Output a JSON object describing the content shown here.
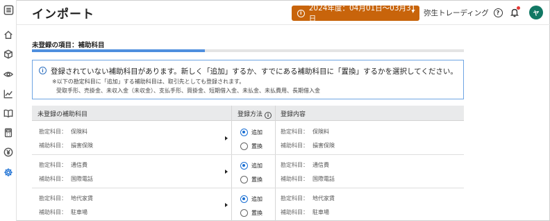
{
  "header": {
    "title": "インポート",
    "period_label": "2024年度：04月01日〜03月31日",
    "company": "弥生トレーディング",
    "avatar_initial": "ヤ"
  },
  "sidebar": {
    "items": [
      {
        "icon": "menu-icon"
      },
      {
        "icon": "home-icon"
      },
      {
        "icon": "box-icon"
      },
      {
        "icon": "eye-icon"
      },
      {
        "icon": "chart-icon"
      },
      {
        "icon": "book-icon"
      },
      {
        "icon": "calculator-icon"
      },
      {
        "icon": "yen-icon"
      },
      {
        "icon": "gear-icon",
        "active": true
      }
    ]
  },
  "section": {
    "title": "未登録の項目：補助科目",
    "progress": 0.4
  },
  "notice": {
    "main": "登録されていない補助科目があります。新しく「追加」するか、すでにある補助科目に「置換」するかを選択してください。",
    "note1": "※以下の勘定科目に「追加」する補助科目は、取引先としても登録されます。",
    "note2": "受取手形、売掛金、未収入金（未収金）、支払手形、買掛金、短期借入金、未払金、未払費用、長期借入金"
  },
  "table": {
    "headers": {
      "unregistered": "未登録の補助科目",
      "method": "登録方法",
      "content": "登録内容"
    },
    "account_label": "勘定科目：",
    "sub_label": "補助科目：",
    "option_add": "追加",
    "option_replace": "置換",
    "rows": [
      {
        "account": "保険料",
        "sub": "損害保険",
        "selected": "add",
        "reg_account": "保険料",
        "reg_sub": "損害保険"
      },
      {
        "account": "通信費",
        "sub": "国際電話",
        "selected": "add",
        "reg_account": "通信費",
        "reg_sub": "国際電話"
      },
      {
        "account": "地代家賃",
        "sub": "駐車場",
        "selected": "add",
        "reg_account": "地代家賃",
        "reg_sub": "駐車場"
      }
    ]
  },
  "colors": {
    "accent": "#1a6fd3",
    "period_bg": "#c8640b",
    "avatar_bg": "#117864",
    "notice_border": "#6ea5e3"
  }
}
